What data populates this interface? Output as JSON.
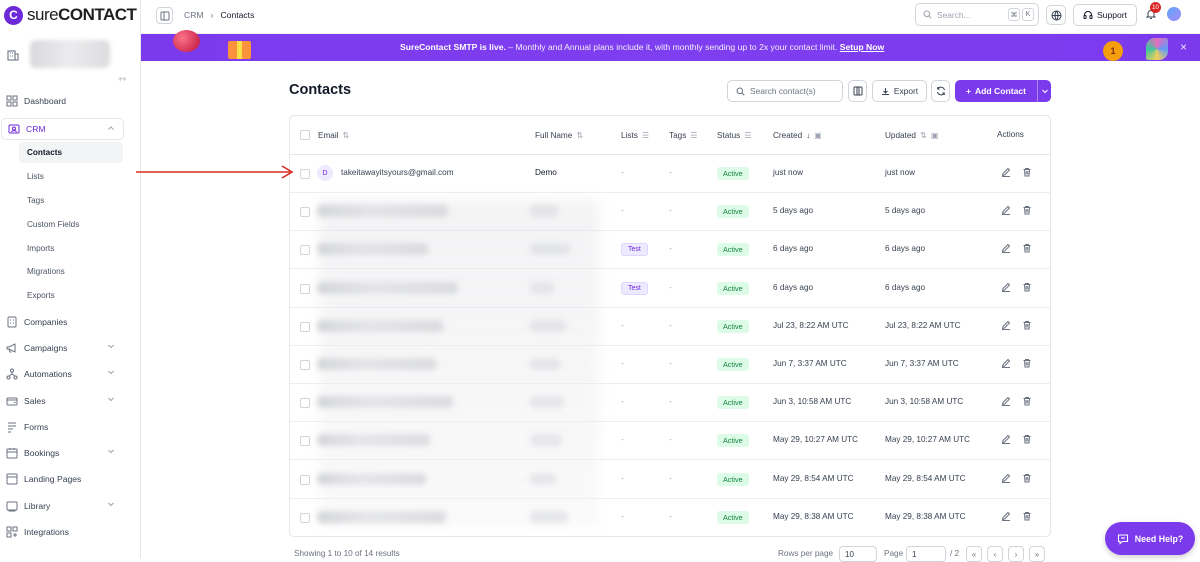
{
  "brand": {
    "logo_letter": "C",
    "name_part1": "sure",
    "name_part2": "CONTACT"
  },
  "sidebar": {
    "items": [
      {
        "label": "Dashboard",
        "icon": "dashboard-icon"
      },
      {
        "label": "CRM",
        "icon": "crm-icon"
      },
      {
        "label": "Companies",
        "icon": "building-icon"
      },
      {
        "label": "Campaigns",
        "icon": "megaphone-icon"
      },
      {
        "label": "Automations",
        "icon": "flow-icon"
      },
      {
        "label": "Sales",
        "icon": "wallet-icon"
      },
      {
        "label": "Forms",
        "icon": "form-icon"
      },
      {
        "label": "Bookings",
        "icon": "calendar-icon"
      },
      {
        "label": "Landing Pages",
        "icon": "page-icon"
      },
      {
        "label": "Library",
        "icon": "library-icon"
      },
      {
        "label": "Integrations",
        "icon": "puzzle-icon"
      }
    ],
    "crm_sub": [
      "Contacts",
      "Lists",
      "Tags",
      "Custom Fields",
      "Imports",
      "Migrations",
      "Exports"
    ]
  },
  "topbar": {
    "crumb_root": "CRM",
    "crumb_current": "Contacts",
    "search_placeholder": "Search...",
    "kbd1": "⌘",
    "kbd2": "K",
    "support_label": "Support",
    "notif_count": "10"
  },
  "banner": {
    "strong": "SureContact SMTP is live.",
    "message": " – Monthly and Annual plans include it, with monthly sending up to 2x your contact limit. ",
    "link": "Setup Now",
    "medal_text": "1"
  },
  "page": {
    "title": "Contacts",
    "search_placeholder": "Search contact(s)",
    "export_label": "Export",
    "add_label": "Add Contact"
  },
  "table": {
    "headers": {
      "email": "Email",
      "name": "Full Name",
      "lists": "Lists",
      "tags": "Tags",
      "status": "Status",
      "created": "Created",
      "updated": "Updated",
      "actions": "Actions"
    },
    "rows": [
      {
        "avatar": "D",
        "email": "takeitawayitsyours@gmail.com",
        "name": "Demo",
        "lists": "-",
        "tags": "-",
        "status": "Active",
        "created": "just now",
        "updated": "just now"
      },
      {
        "avatar": "",
        "email": "",
        "name": "",
        "lists": "-",
        "tags": "-",
        "status": "Active",
        "created": "5 days ago",
        "updated": "5 days ago"
      },
      {
        "avatar": "",
        "email": "",
        "name": "",
        "lists": "Test",
        "tags": "-",
        "status": "Active",
        "created": "6 days ago",
        "updated": "6 days ago"
      },
      {
        "avatar": "",
        "email": "",
        "name": "",
        "lists": "Test",
        "tags": "-",
        "status": "Active",
        "created": "6 days ago",
        "updated": "6 days ago"
      },
      {
        "avatar": "",
        "email": "",
        "name": "",
        "lists": "-",
        "tags": "-",
        "status": "Active",
        "created": "Jul 23, 8:22 AM UTC",
        "updated": "Jul 23, 8:22 AM UTC"
      },
      {
        "avatar": "",
        "email": "",
        "name": "",
        "lists": "-",
        "tags": "-",
        "status": "Active",
        "created": "Jun 7, 3:37 AM UTC",
        "updated": "Jun 7, 3:37 AM UTC"
      },
      {
        "avatar": "",
        "email": "",
        "name": "",
        "lists": "-",
        "tags": "-",
        "status": "Active",
        "created": "Jun 3, 10:58 AM UTC",
        "updated": "Jun 3, 10:58 AM UTC"
      },
      {
        "avatar": "",
        "email": "",
        "name": "",
        "lists": "-",
        "tags": "-",
        "status": "Active",
        "created": "May 29, 10:27 AM UTC",
        "updated": "May 29, 10:27 AM UTC"
      },
      {
        "avatar": "",
        "email": "",
        "name": "",
        "lists": "-",
        "tags": "-",
        "status": "Active",
        "created": "May 29, 8:54 AM UTC",
        "updated": "May 29, 8:54 AM UTC"
      },
      {
        "avatar": "",
        "email": "",
        "name": "",
        "lists": "-",
        "tags": "-",
        "status": "Active",
        "created": "May 29, 8:38 AM UTC",
        "updated": "May 29, 8:38 AM UTC"
      }
    ]
  },
  "footer": {
    "results": "Showing 1 to 10 of 14 results",
    "rows_label": "Rows per page",
    "rows_value": "10",
    "page_label": "Page",
    "page_value": "1",
    "page_total": "/ 2"
  },
  "help": {
    "label": "Need Help?"
  },
  "colors": {
    "accent": "#7c3aed",
    "status_bg": "#dcfce7",
    "status_text": "#15803d",
    "annotation_arrow": "#d62d20"
  }
}
